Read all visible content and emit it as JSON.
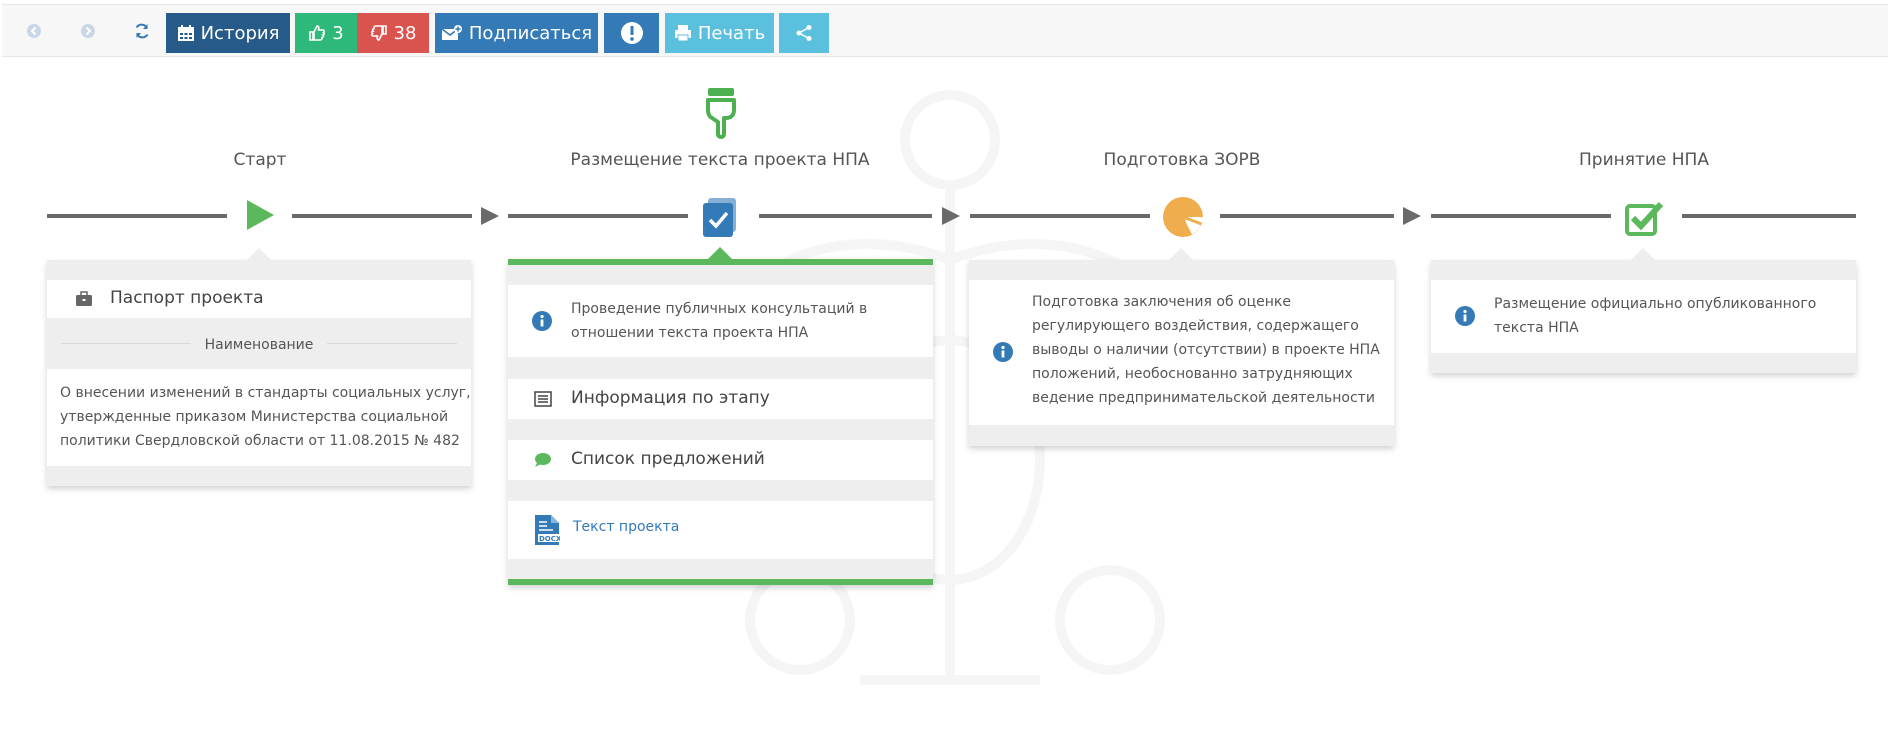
{
  "toolbar": {
    "history_label": "История",
    "likes": "3",
    "dislikes": "38",
    "subscribe_label": "Подписаться",
    "print_label": "Печать"
  },
  "colors": {
    "primary": "#265a88",
    "success": "#2eb87a",
    "danger": "#d9534f",
    "info_blue": "#337ab7",
    "light_info": "#5bc0de",
    "stage_green": "#5cb85c",
    "stage_orange": "#f0ad4e"
  },
  "stages": [
    {
      "title": "Старт",
      "icon": "play-icon",
      "card": {
        "header_label": "Паспорт проекта",
        "header_icon": "briefcase-icon",
        "divider_label": "Наименование",
        "lines": [
          "О внесении изменений в стандарты социальных услуг,",
          "утвержденные приказом Министерства социальной",
          "политики Свердловской области от 11.08.2015 № 482"
        ]
      }
    },
    {
      "title": "Размещение текста проекта НПА",
      "icon": "checked-document-icon",
      "marker_icon": "thumbs-down-icon",
      "card": {
        "info_lines": [
          "Проведение публичных консультаций в",
          "отношении текста проекта НПА"
        ],
        "stage_info_label": "Информация по этапу",
        "proposals_label": "Список предложений",
        "project_text_label": "Текст проекта",
        "file_icon": "docx-file-icon"
      }
    },
    {
      "title": "Подготовка ЗОРВ",
      "icon": "pie-chart-icon",
      "card": {
        "info_lines": [
          "Подготовка заключения об оценке",
          "регулирующего воздействия, содержащего",
          "выводы о наличии (отсутствии) в проекте НПА",
          "положений, необоснованно затрудняющих",
          "ведение предпринимательской деятельности"
        ]
      }
    },
    {
      "title": "Принятие НПА",
      "icon": "checkbox-icon",
      "card": {
        "info_lines": [
          "Размещение официально опубликованного",
          "текста НПА"
        ]
      }
    }
  ]
}
